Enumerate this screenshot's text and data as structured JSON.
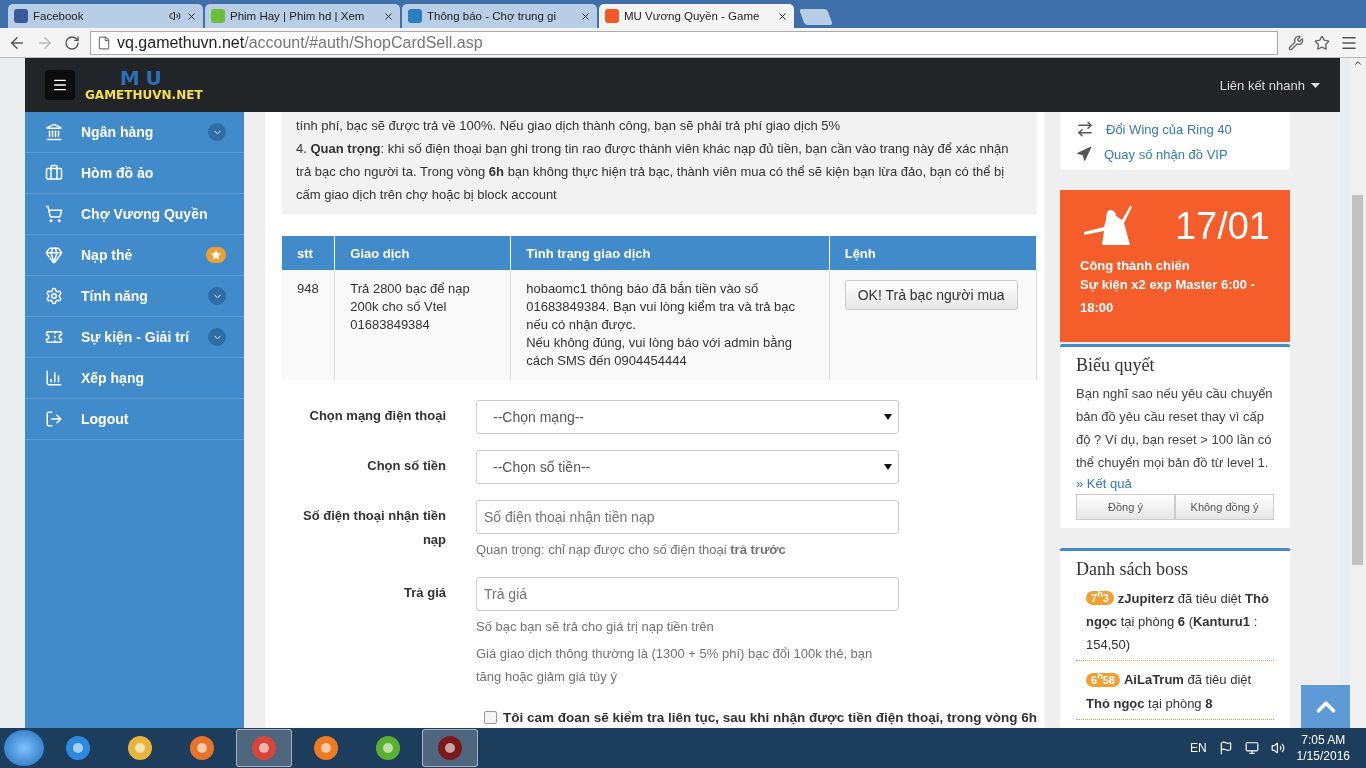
{
  "browser": {
    "tabs": [
      {
        "title": "Facebook",
        "selected": false,
        "audio": true
      },
      {
        "title": "Phim Hay | Phim hd | Xem",
        "selected": false,
        "audio": false
      },
      {
        "title": "Thông báo - Chợ trung gi",
        "selected": false,
        "audio": false
      },
      {
        "title": "MU Vương Quyền - Game",
        "selected": true,
        "audio": false
      }
    ],
    "address": {
      "host": "vq.gamethuvn.net",
      "path": "/account/#auth/ShopCardSell.asp"
    }
  },
  "navbar": {
    "logo_mark": "MU",
    "logo_name": "GAMETHUVN.NET",
    "quick_links": "Liên kết nhanh"
  },
  "sidebar": {
    "items": [
      {
        "label": "Ngân hàng",
        "kind": "dropdown"
      },
      {
        "label": "Hòm đồ ảo",
        "kind": "plain"
      },
      {
        "label": "Chợ Vương Quyền",
        "kind": "plain"
      },
      {
        "label": "Nạp thẻ",
        "kind": "star"
      },
      {
        "label": "Tính năng",
        "kind": "dropdown"
      },
      {
        "label": "Sự kiện - Giải trí",
        "kind": "dropdown"
      },
      {
        "label": "Xếp hạng",
        "kind": "plain"
      },
      {
        "label": "Logout",
        "kind": "plain"
      }
    ]
  },
  "notice": [
    "tính phí, bạc sẽ được trả về 100%. Nếu giao dịch thành công, bạn sẽ phải trả phí giao dịch 5%",
    "4. **Quan trọng**: khi số điện thoại bạn ghi trong tin rao được thành viên khác nạp đủ tiền, bạn cần vào trang này để xác nhận trả bạc cho người ta. Trong vòng **6h** bạn không thực hiện trả bạc, thành viên mua có thể sẽ kiện bạn lừa đảo, bạn có thể bị cấm giao dịch trên chợ hoặc bị block account"
  ],
  "table": {
    "columns": [
      "stt",
      "Giao dịch",
      "Tình trạng giao dịch",
      "Lệnh"
    ],
    "rows": [
      {
        "stt": "948",
        "transaction": "Trả 2800 bạc để nạp 200k cho số Vtel 01683849384",
        "status": [
          "hobaomc1 thông báo đã bắn tiền vào số 01683849384. Bạn vui lòng kiểm tra và trả bạc nếu có nhận được.",
          "Nếu không đúng, vui lòng báo với admin bằng cách SMS đến 0904454444"
        ],
        "action": "OK! Trả bạc người mua"
      }
    ]
  },
  "form": [
    {
      "kind": "select",
      "label": "Chọn mạng điện thoại",
      "value": "--Chọn mạng--"
    },
    {
      "kind": "select",
      "label": "Chọn số tiền",
      "value": "--Chọn số tiền--"
    },
    {
      "kind": "input",
      "label": "Số điện thoại nhận tiền nạp",
      "placeholder": "Số điện thoại nhận tiền nạp",
      "help": [
        "Quan trọng: chỉ nạp được cho số điện thoại **trả trước**"
      ]
    },
    {
      "kind": "input",
      "label": "Trả giá",
      "placeholder": "Trả giá",
      "help": [
        "Số bạc bạn sẽ trả cho giá trị nạp tiền trên",
        "Giá giao dịch thông thường là (1300 + 5% phí) bạc đổi 100k thẻ, bạn tăng hoặc giảm giá tùy ý"
      ]
    },
    {
      "kind": "checkbox",
      "label": "Tôi cam đoan sẽ kiểm tra liên tục, sau khi nhận được tiền điện thoại, trong vòng 6h",
      "checked": false
    }
  ],
  "links": [
    "Đổi Wing của Ring 40",
    "Quay số nhận đồ VIP"
  ],
  "event": {
    "date": "17/01",
    "title": "Công thành chiến",
    "detail": "Sự kiện x2 exp Master 6:00 - 18:00"
  },
  "poll": {
    "title": "Biểu quyết",
    "question": "Bạn nghĩ sao nếu yêu cầu chuyển bản đồ yêu cầu reset thay vì cấp độ ? Ví dụ, bạn reset > 100 lần có thể chuyển mọi bản đồ từ level 1.",
    "results": "» Kết quả",
    "buttons": [
      "Đồng ý",
      "Không đồng ý"
    ]
  },
  "bosses": {
    "title": "Danh sách boss",
    "items": [
      {
        "time": "7$^{h}$3",
        "text": "**zJupiterz** đã tiêu diệt **Thỏ ngọc** tại phòng **6** (**Kanturu1** : 154,50)"
      },
      {
        "time": "6$^{h}$58",
        "text": "**AiLaTrum** đã tiêu diệt **Thỏ ngọc** tại phòng **8**"
      }
    ]
  },
  "taskbar": {
    "apps": [
      {
        "running": false
      },
      {
        "running": false
      },
      {
        "running": false
      },
      {
        "running": true
      },
      {
        "running": false
      },
      {
        "running": false
      },
      {
        "running": true
      }
    ],
    "language": "EN",
    "time": "7:05 AM",
    "date": "1/15/2016"
  }
}
